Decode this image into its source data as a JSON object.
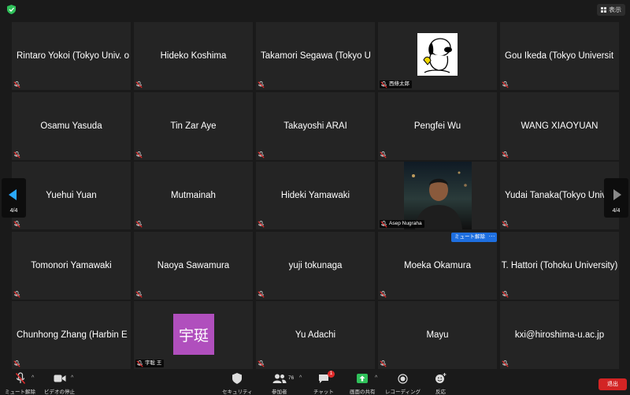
{
  "topbar": {
    "view_label": "表示"
  },
  "participants": [
    {
      "name": "Rintaro Yokoi (Tokyo Univ. o",
      "clip": true
    },
    {
      "name": "Hideko Koshima"
    },
    {
      "name": "Takamori Segawa (Tokyo U",
      "clip": true
    },
    {
      "name": "",
      "label": "西條太郎",
      "kind": "snoopy"
    },
    {
      "name": "Gou Ikeda (Tokyo Universit",
      "clip": true
    },
    {
      "name": "Osamu Yasuda"
    },
    {
      "name": "Tin Zar Aye"
    },
    {
      "name": "Takayoshi ARAI"
    },
    {
      "name": "Pengfei Wu"
    },
    {
      "name": "WANG XIAOYUAN"
    },
    {
      "name": "Yuehui Yuan"
    },
    {
      "name": "Mutmainah"
    },
    {
      "name": "Hideki Yamawaki"
    },
    {
      "name": "",
      "label": "Asep Nugraha",
      "kind": "photo"
    },
    {
      "name": "Yudai Tanaka(Tokyo Univ.",
      "clip": true
    },
    {
      "name": "Tomonori Yamawaki"
    },
    {
      "name": "Naoya Sawamura"
    },
    {
      "name": "yuji tokunaga"
    },
    {
      "name": "Moeka Okamura"
    },
    {
      "name": "T. Hattori (Tohoku University)"
    },
    {
      "name": "Chunhong Zhang (Harbin E",
      "clip": true
    },
    {
      "name": "",
      "label": "宇聡 王",
      "kind": "avatar",
      "avatar_text": "宇珽"
    },
    {
      "name": "Yu Adachi"
    },
    {
      "name": "Mayu"
    },
    {
      "name": "kxi@hiroshima-u.ac.jp"
    }
  ],
  "hover_menu": {
    "mute_label": "ミュート解除",
    "more_label": "···"
  },
  "nav": {
    "left_page": "4/4",
    "right_page": "4/4"
  },
  "toolbar": {
    "unmute": "ミュート解除",
    "video_stop": "ビデオの停止",
    "security": "セキュリティ",
    "participants": "参加者",
    "participants_count": "76",
    "chat": "チャット",
    "chat_badge": "1",
    "share": "画面の共有",
    "record": "レコーディング",
    "reactions": "反応",
    "leave": "退出"
  },
  "colors": {
    "accent": "#1e6fe0",
    "leave": "#d32424",
    "share_green": "#2fc15a",
    "muted_red": "#e02b2b"
  }
}
